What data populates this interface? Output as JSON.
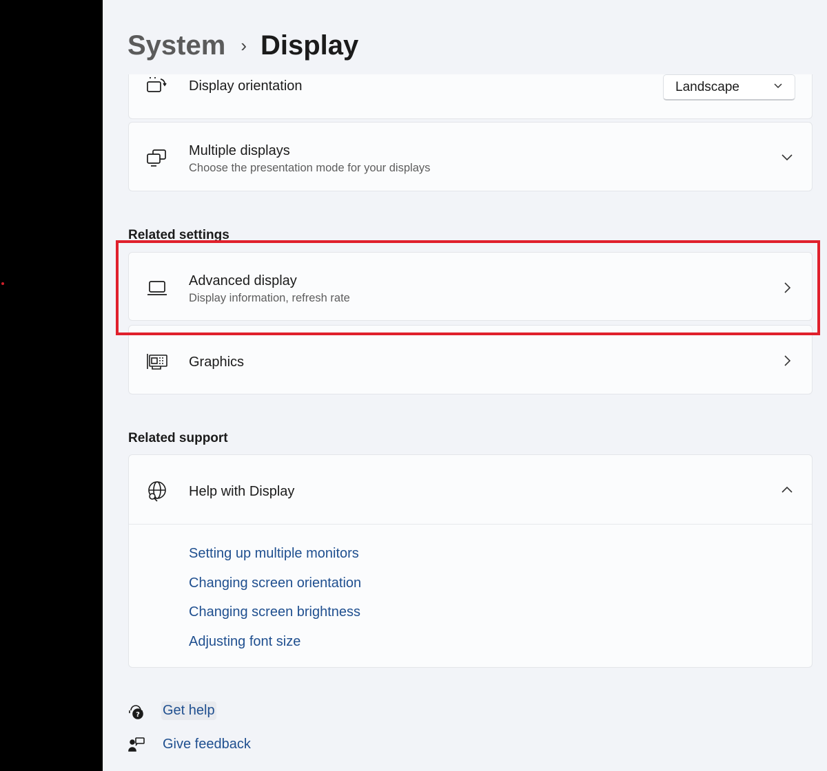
{
  "breadcrumb": {
    "parent": "System",
    "separator": "›",
    "current": "Display"
  },
  "display_orientation": {
    "label": "Display orientation",
    "value": "Landscape",
    "icon": "orientation-icon"
  },
  "multiple_displays": {
    "label": "Multiple displays",
    "description": "Choose the presentation mode for your displays",
    "icon": "multiple-displays-icon"
  },
  "related_settings": {
    "heading": "Related settings",
    "items": [
      {
        "label": "Advanced display",
        "description": "Display information, refresh rate",
        "icon": "laptop-icon"
      },
      {
        "label": "Graphics",
        "icon": "graphics-card-icon"
      }
    ]
  },
  "related_support": {
    "heading": "Related support",
    "help": {
      "label": "Help with Display",
      "icon": "globe-search-icon",
      "links": [
        "Setting up multiple monitors",
        "Changing screen orientation",
        "Changing screen brightness",
        "Adjusting font size"
      ]
    }
  },
  "footer": {
    "get_help": "Get help",
    "give_feedback": "Give feedback"
  },
  "colors": {
    "accent_link": "#1f4f8f",
    "highlight": "#e0202c",
    "background": "#f2f4f8",
    "card": "#fbfcfd"
  }
}
